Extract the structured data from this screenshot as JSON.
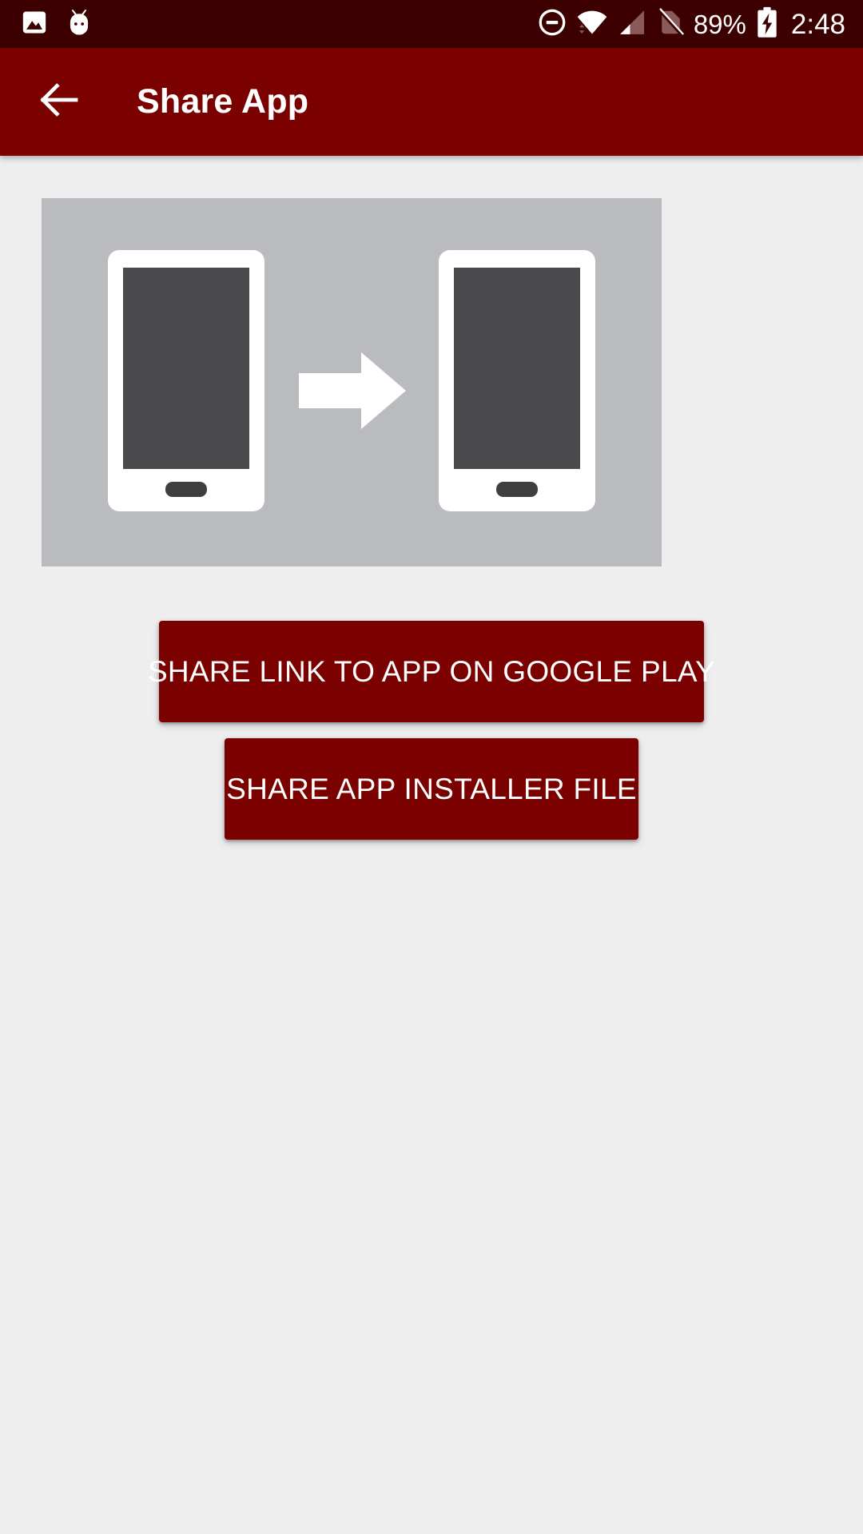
{
  "status_bar": {
    "background_color": "#3c0000",
    "left_icons": [
      {
        "name": "image-icon",
        "label": "Screenshot"
      },
      {
        "name": "android-head-icon",
        "label": "Android System"
      }
    ],
    "right_icons": [
      {
        "name": "do-not-disturb-icon",
        "label": "Do not disturb"
      },
      {
        "name": "wifi-icon",
        "label": "Wi-Fi connected"
      },
      {
        "name": "cellular-signal-icon",
        "label": "Mobile signal"
      },
      {
        "name": "no-sim-icon",
        "label": "No SIM card"
      }
    ],
    "battery_percent": "89%",
    "battery_state": "charging",
    "time": "2:48"
  },
  "app_bar": {
    "background_color": "#7b0000",
    "back_icon": "arrow-back-icon",
    "title": "Share App"
  },
  "content": {
    "background_color": "#eeeeee",
    "illustration": {
      "name": "share-app-illustration",
      "background_color": "#b9bbbe",
      "device_body_color": "#ffffff",
      "device_screen_color": "#4a4a4d",
      "arrow_color": "#ffffff",
      "devices": 2,
      "arrow_direction": "right"
    },
    "buttons": [
      {
        "name": "share-link-google-play-button",
        "label": "SHARE LINK TO APP ON GOOGLE PLAY",
        "color": "#7b0000",
        "text_color": "#ffffff"
      },
      {
        "name": "share-installer-file-button",
        "label": "SHARE APP INSTALLER FILE",
        "color": "#7b0000",
        "text_color": "#ffffff"
      }
    ]
  }
}
